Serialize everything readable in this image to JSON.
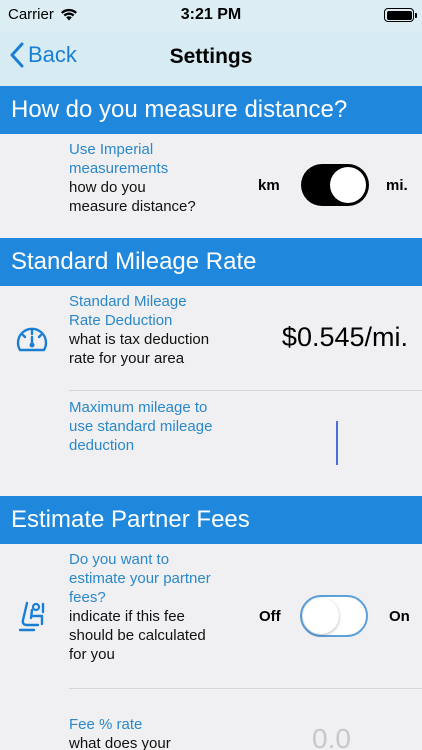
{
  "status_bar": {
    "carrier": "Carrier",
    "time": "3:21 PM",
    "battery_level": 1.0
  },
  "nav": {
    "back_label": "Back",
    "title": "Settings"
  },
  "sections": {
    "distance": {
      "header": "How do you measure distance?",
      "setting": {
        "title_line1": "Use Imperial",
        "title_line2": "measurements",
        "desc_line1": "how do you",
        "desc_line2": "measure distance?",
        "left_label": "km",
        "right_label": "mi.",
        "state": "on"
      }
    },
    "mileage": {
      "header": "Standard Mileage Rate",
      "rate": {
        "icon": "speedometer-icon",
        "title_line1": "Standard Mileage",
        "title_line2": "Rate Deduction",
        "desc_line1": "what is tax deduction",
        "desc_line2": "rate for your area",
        "value": "$0.545/mi."
      },
      "max": {
        "title_line1": "Maximum mileage to",
        "title_line2": "use standard mileage",
        "title_line3": "deduction",
        "value": ""
      }
    },
    "fees": {
      "header": "Estimate Partner Fees",
      "estimate": {
        "icon": "car-seat-icon",
        "title_line1": "Do you want to",
        "title_line2": "estimate your partner",
        "title_line3": "fees?",
        "desc_line1": "indicate if this fee",
        "desc_line2": "should be calculated",
        "desc_line3": "for you",
        "left_label": "Off",
        "right_label": "On",
        "state": "off"
      },
      "rate": {
        "title": "Fee % rate",
        "desc_line1": "what does your",
        "value": "0.0"
      }
    }
  },
  "colors": {
    "accent": "#1f88dc",
    "link": "#1a7fd4",
    "label_blue": "#2a88c8",
    "background": "#f0f0f2",
    "nav_bg": "#d6ebf2"
  }
}
